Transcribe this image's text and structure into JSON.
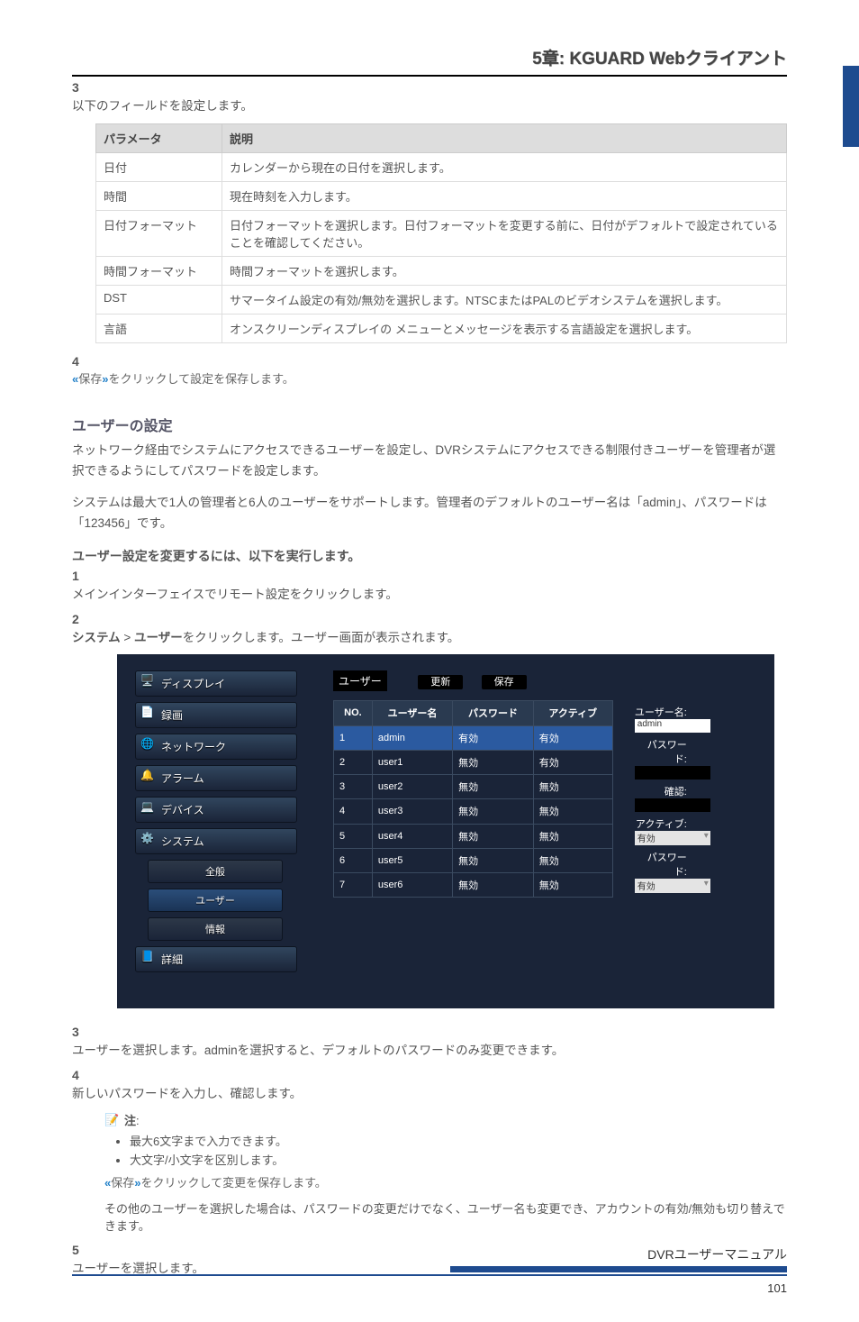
{
  "header": {
    "chapter": "5章: KGUARD Webクライアント"
  },
  "step3": {
    "num": "3",
    "text": "以下のフィールドを設定します。",
    "table": {
      "head": [
        "パラメータ",
        "説明"
      ],
      "rows": [
        [
          "日付",
          "カレンダーから現在の日付を選択します。"
        ],
        [
          "時間",
          "現在時刻を入力します。"
        ],
        [
          "日付フォーマット",
          "日付フォーマットを選択します。日付フォーマットを変更する前に、日付がデフォルトで設定されていることを確認してください。"
        ],
        [
          "時間フォーマット",
          "時間フォーマットを選択します。"
        ],
        [
          "DST",
          "サマータイム設定の有効/無効を選択します。NTSCまたはPALのビデオシステムを選択します。"
        ],
        [
          "言語",
          "オンスクリーンディスプレイの メニューとメッセージを表示する言語設定を選択します。"
        ]
      ]
    }
  },
  "step4": {
    "num": "4",
    "line": [
      "«",
      "保存",
      "»",
      "をクリックして設定を保存します。"
    ]
  },
  "sectionUser": {
    "title": "ユーザーの設定",
    "body": "ネットワーク経由でシステムにアクセスできるユーザーを設定し、DVRシステムにアクセスできる制限付きユーザーを管理者が選択できるようにしてパスワードを設定します。",
    "body2p1": "システムは最大で1人の管理者と6人のユーザーをサポートします。管理者のデフォルトのユーザー名は「admin」、パスワードは「123456」です。",
    "sub": "ユーザー設定を変更するには、以下を実行します。",
    "s1": {
      "num": "1",
      "text": "メインインターフェイスでリモート設定をクリックします。"
    },
    "s2": {
      "num": "2",
      "text": [
        "システム",
        " > ",
        "ユーザー",
        "をクリックします。ユーザー画面が表示されます。"
      ]
    }
  },
  "ui": {
    "menu": [
      "ディスプレイ",
      "録画",
      "ネットワーク",
      "アラーム",
      "デバイス",
      "システム"
    ],
    "submenu": [
      "全般",
      "ユーザー",
      "情報"
    ],
    "menu2": "詳細",
    "panel": "ユーザー",
    "btnRefresh": "更新",
    "btnSave": "保存",
    "thead": [
      "NO.",
      "ユーザー名",
      "パスワード",
      "アクティブ"
    ],
    "rows": [
      [
        "1",
        "admin",
        "有効",
        "有効"
      ],
      [
        "2",
        "user1",
        "無効",
        "有効"
      ],
      [
        "3",
        "user2",
        "無効",
        "無効"
      ],
      [
        "4",
        "user3",
        "無効",
        "無効"
      ],
      [
        "5",
        "user4",
        "無効",
        "無効"
      ],
      [
        "6",
        "user5",
        "無効",
        "無効"
      ],
      [
        "7",
        "user6",
        "無効",
        "無効"
      ]
    ],
    "form": {
      "uLabel": "ユーザー名:",
      "uVal": "admin",
      "pLabel": "パスワード:",
      "cLabel": "確認:",
      "aLabel": "アクティブ:",
      "aVal": "有効",
      "p2Label": "パスワード:",
      "p2Val": "有効"
    }
  },
  "step3b": {
    "num": "3",
    "text": "ユーザーを選択します。adminを選択すると、デフォルトのパスワードのみ変更できます。"
  },
  "step4b": {
    "num": "4",
    "text": "新しいパスワードを入力し、確認します。",
    "noteLabel": "注",
    "noteColon": ":",
    "notes": [
      "最大6文字まで入力できます。",
      "大文字/小文字を区別します。"
    ],
    "line": [
      "«",
      "保存",
      "»",
      "をクリックして変更を保存します。"
    ],
    "tail": "その他のユーザーを選択した場合は、パスワードの変更だけでなく、ユーザー名も変更でき、アカウントの有効/無効も切り替えできます。"
  },
  "step5": {
    "num": "5",
    "text": "ユーザーを選択します。"
  },
  "footer": {
    "text": "DVRユーザーマニュアル",
    "page": "101"
  },
  "icons": {
    "display": "🖥️",
    "rec": "📄",
    "net": "🌐",
    "alarm": "🔔",
    "dev": "💻",
    "sys": "⚙️",
    "detail": "📘",
    "note": "📝"
  }
}
